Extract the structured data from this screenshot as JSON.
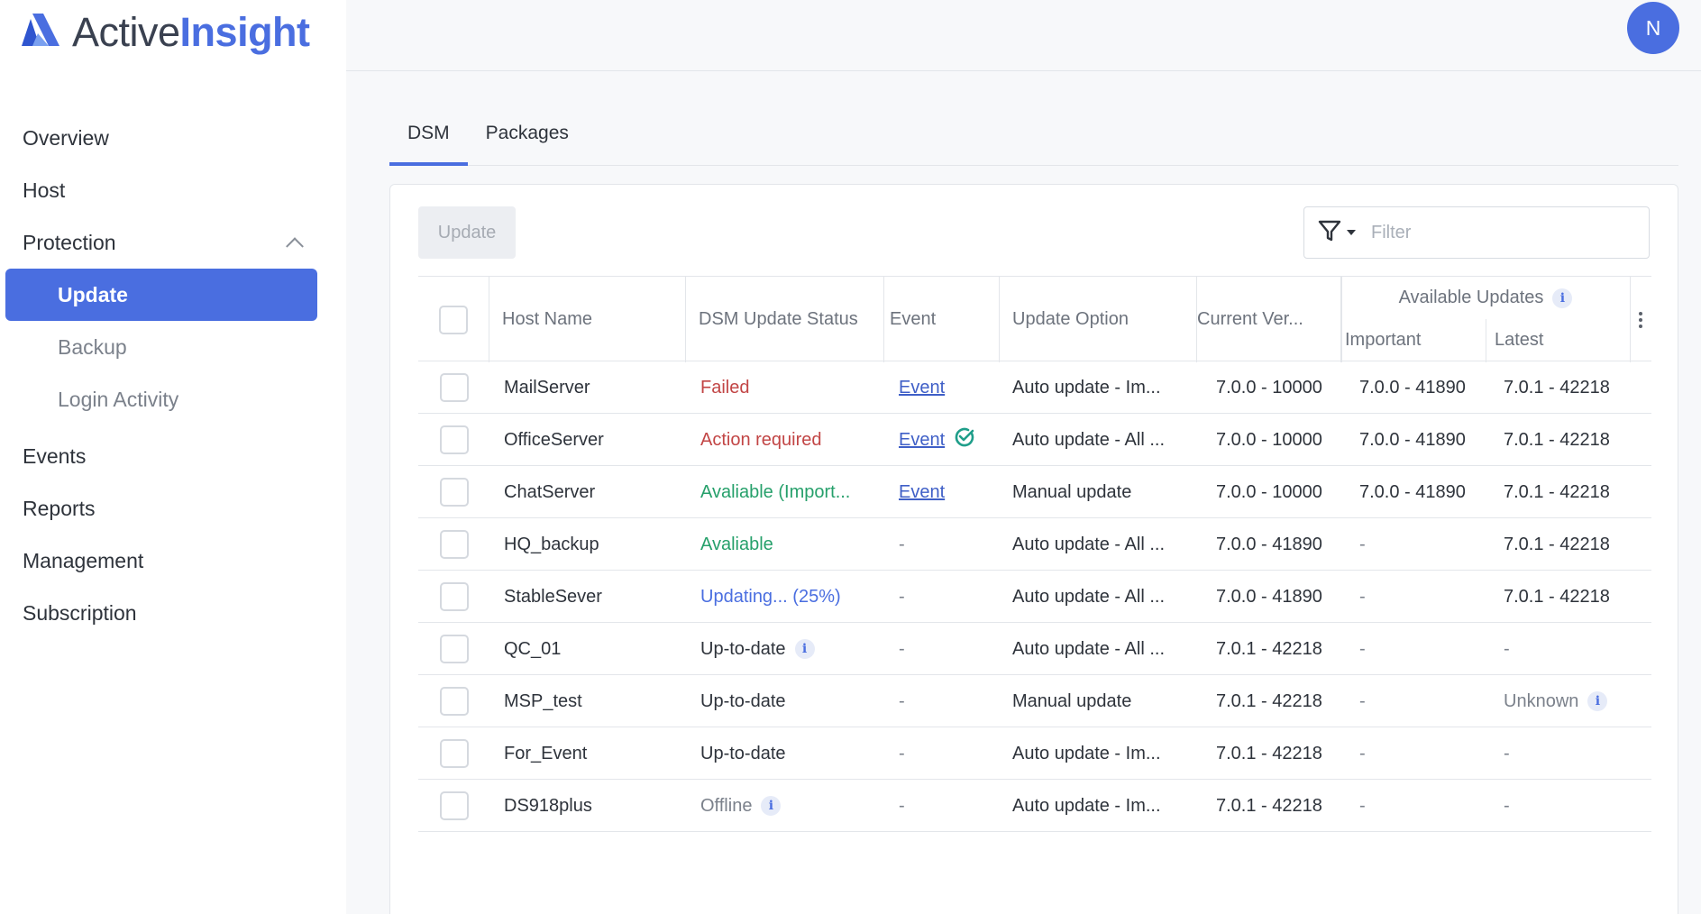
{
  "app": {
    "logo_text_a": "Active",
    "logo_text_b": "Insight",
    "user_initial": "N",
    "brand_color": "#4a6ee0"
  },
  "sidebar": {
    "items": [
      {
        "label": "Overview"
      },
      {
        "label": "Host"
      },
      {
        "label": "Protection"
      },
      {
        "label": "Update"
      },
      {
        "label": "Backup"
      },
      {
        "label": "Login Activity"
      },
      {
        "label": "Events"
      },
      {
        "label": "Reports"
      },
      {
        "label": "Management"
      },
      {
        "label": "Subscription"
      }
    ]
  },
  "tabs": [
    {
      "label": "DSM"
    },
    {
      "label": "Packages"
    }
  ],
  "toolbar": {
    "update_label": "Update",
    "filter_placeholder": "Filter"
  },
  "table": {
    "headers": {
      "host_name": "Host Name",
      "status": "DSM Update Status",
      "event": "Event",
      "update_option": "Update Option",
      "current_ver": "Current Ver...",
      "available_updates": "Available Updates",
      "important": "Important",
      "latest": "Latest"
    },
    "rows": [
      {
        "host": "MailServer",
        "status": "Failed",
        "status_type": "failed",
        "event": "Event",
        "event_check": false,
        "option": "Auto update - Im...",
        "current": "7.0.0 - 10000",
        "important": "7.0.0 - 41890",
        "latest": "7.0.1 - 42218"
      },
      {
        "host": "OfficeServer",
        "status": "Action required",
        "status_type": "action",
        "event": "Event",
        "event_check": true,
        "option": "Auto update - All ...",
        "current": "7.0.0 - 10000",
        "important": "7.0.0 - 41890",
        "latest": "7.0.1 - 42218"
      },
      {
        "host": "ChatServer",
        "status": "Avaliable (Import...",
        "status_type": "avail",
        "event": "Event",
        "event_check": false,
        "option": "Manual update",
        "current": "7.0.0 - 10000",
        "important": "7.0.0 - 41890",
        "latest": "7.0.1 - 42218"
      },
      {
        "host": "HQ_backup",
        "status": "Avaliable",
        "status_type": "avail",
        "event": "-",
        "event_check": false,
        "option": "Auto update - All ...",
        "current": "7.0.0 - 41890",
        "important": "-",
        "latest": "7.0.1 - 42218"
      },
      {
        "host": "StableSever",
        "status": "Updating... (25%)",
        "status_type": "updating",
        "event": "-",
        "event_check": false,
        "option": "Auto update - All ...",
        "current": "7.0.0 - 41890",
        "important": "-",
        "latest": "7.0.1 - 42218"
      },
      {
        "host": "QC_01",
        "status": "Up-to-date",
        "status_type": "uptodate",
        "status_info": true,
        "event": "-",
        "event_check": false,
        "option": "Auto update - All ...",
        "current": "7.0.1 - 42218",
        "important": "-",
        "latest": "-"
      },
      {
        "host": "MSP_test",
        "status": "Up-to-date",
        "status_type": "uptodate",
        "event": "-",
        "event_check": false,
        "option": "Manual update",
        "current": "7.0.1 - 42218",
        "important": "-",
        "latest": "Unknown",
        "latest_info": true
      },
      {
        "host": "For_Event",
        "status": "Up-to-date",
        "status_type": "uptodate",
        "event": "-",
        "event_check": false,
        "option": "Auto update - Im...",
        "current": "7.0.1 - 42218",
        "important": "-",
        "latest": "-"
      },
      {
        "host": "DS918plus",
        "status": "Offline",
        "status_type": "offline",
        "status_info": true,
        "event": "-",
        "event_check": false,
        "option": "Auto update - Im...",
        "current": "7.0.1 - 42218",
        "important": "-",
        "latest": "-"
      }
    ]
  }
}
